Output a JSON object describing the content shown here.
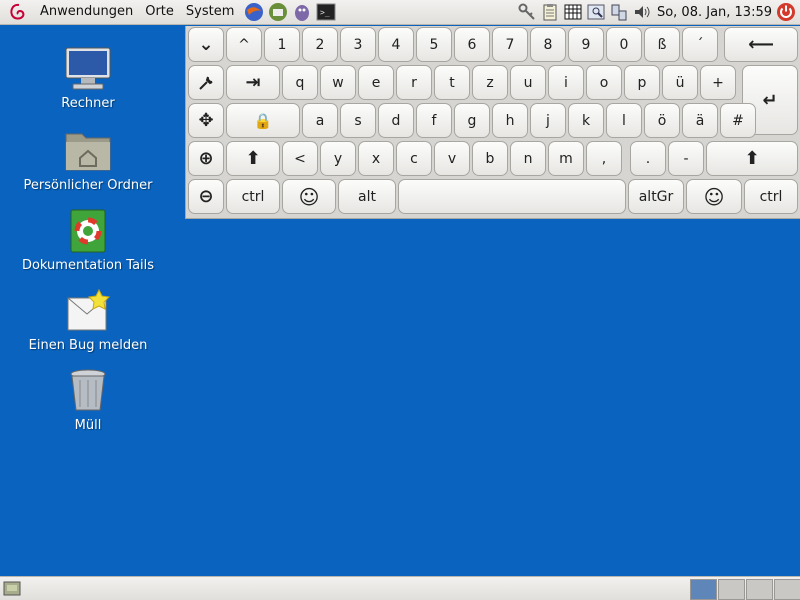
{
  "top_panel": {
    "menus": [
      "Anwendungen",
      "Orte",
      "System"
    ],
    "clock": "So, 08. Jan, 13:59"
  },
  "desktop": {
    "icons": [
      {
        "label": "Rechner",
        "icon": "computer-icon"
      },
      {
        "label": "Persönlicher Ordner",
        "icon": "home-folder-icon"
      },
      {
        "label": "Dokumentation Tails",
        "icon": "help-docs-icon"
      },
      {
        "label": "Einen Bug melden",
        "icon": "bug-report-icon"
      },
      {
        "label": "Müll",
        "icon": "trash-icon"
      }
    ]
  },
  "keyboard": {
    "row1": [
      "^",
      "1",
      "2",
      "3",
      "4",
      "5",
      "6",
      "7",
      "8",
      "9",
      "0",
      "ß",
      "´"
    ],
    "row2": [
      "q",
      "w",
      "e",
      "r",
      "t",
      "z",
      "u",
      "i",
      "o",
      "p",
      "ü",
      "+"
    ],
    "row3": [
      "a",
      "s",
      "d",
      "f",
      "g",
      "h",
      "j",
      "k",
      "l",
      "ö",
      "ä",
      "#"
    ],
    "row4": [
      "<",
      "y",
      "x",
      "c",
      "v",
      "b",
      "n",
      "m",
      ",",
      ".",
      "-"
    ],
    "mods": {
      "ctrl_left": "ctrl",
      "alt": "alt",
      "altgr": "altGr",
      "ctrl_right": "ctrl"
    },
    "icons": {
      "hide": "⌄",
      "backspace": "⟵",
      "settings": "wrench-icon",
      "tab": "⇥",
      "enter": "↵",
      "move": "✥",
      "capslock": "🔒",
      "zoom_in": "⊕",
      "shift": "⬆",
      "zoom_out": "⊖",
      "smiley": "☺"
    }
  },
  "bottom_panel": {
    "workspaces": 4,
    "active_workspace": 1
  }
}
